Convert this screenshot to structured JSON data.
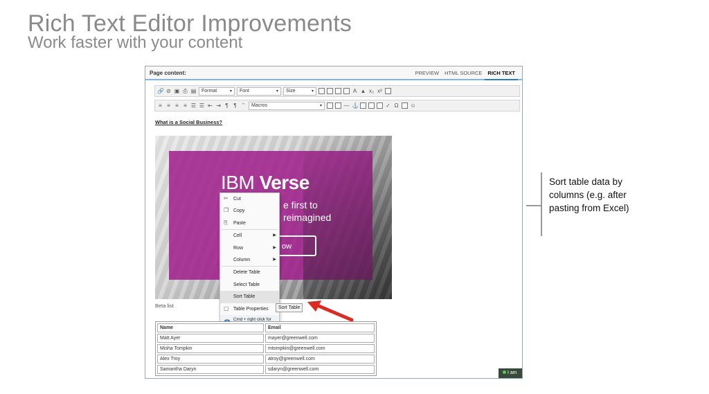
{
  "slide": {
    "title": "Rich Text Editor Improvements",
    "subtitle": "Work faster with your content"
  },
  "editor": {
    "label": "Page content:",
    "tabs": [
      {
        "label": "PREVIEW",
        "active": false
      },
      {
        "label": "HTML SOURCE",
        "active": false
      },
      {
        "label": "RICH TEXT",
        "active": true
      }
    ],
    "toolbar": {
      "format": "Format",
      "font": "Font",
      "size": "Size",
      "macros": "Macros"
    },
    "heading": "What is a Social Business?",
    "hero": {
      "brand_light": "IBM ",
      "brand_bold": "Verse",
      "line1": "e first to",
      "line2": "reimagined",
      "button": "ow"
    },
    "beta_label": "Beta list",
    "context_menu": [
      {
        "label": "Cut",
        "icon": "cut-icon",
        "submenu": false
      },
      {
        "label": "Copy",
        "icon": "copy-icon",
        "submenu": false
      },
      {
        "label": "Paste",
        "icon": "paste-icon",
        "submenu": false
      },
      {
        "label": "Cell",
        "icon": "",
        "submenu": true
      },
      {
        "label": "Row",
        "icon": "",
        "submenu": true
      },
      {
        "label": "Column",
        "icon": "",
        "submenu": true
      },
      {
        "label": "Delete Table",
        "icon": "",
        "submenu": false
      },
      {
        "label": "Select Table",
        "icon": "",
        "submenu": false
      },
      {
        "label": "Sort Table",
        "icon": "",
        "submenu": false,
        "hover": true
      },
      {
        "label": "Table Properties",
        "icon": "table-properties-icon",
        "submenu": false
      }
    ],
    "context_hint": "Cmd + right click for more options",
    "tooltip": "Sort Table",
    "table": {
      "headers": [
        "Name",
        "Email"
      ],
      "rows": [
        [
          "Matt Ayer",
          "mayer@greenwell.com"
        ],
        [
          "Misha Tompkin",
          "mtompkin@greenwell.com"
        ],
        [
          "Alex Troy",
          "atroy@greenwell.com"
        ],
        [
          "Samantha Daryn",
          "sdaryn@greenwell.com"
        ]
      ]
    },
    "chat_badge": "I am"
  },
  "callout": {
    "text": "Sort table data by columns (e.g. after pasting from Excel)"
  },
  "colors": {
    "accent": "#2a7fb0",
    "hero_magenta": "#a01e8c",
    "arrow_red": "#e0281e",
    "title_gray": "#8a8a8a"
  }
}
